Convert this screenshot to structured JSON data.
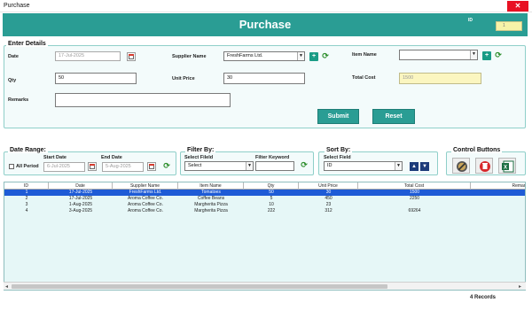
{
  "window": {
    "title": "Purchase",
    "close_glyph": "✕"
  },
  "header": {
    "title": "Purchase",
    "id_label": "ID",
    "id_value": "1"
  },
  "details": {
    "group_title": "Enter Details",
    "date_label": "Date",
    "date_value": "17-Jul-2025",
    "supplier_label": "Supplier Name",
    "supplier_value": "FreshFarms Ltd.",
    "item_label": "Item Name",
    "item_value": "",
    "qty_label": "Qty",
    "qty_value": "50",
    "unit_price_label": "Unit Price",
    "unit_price_value": "30",
    "total_cost_label": "Total Cost",
    "total_cost_value": "1500",
    "remarks_label": "Remarks",
    "remarks_value": "",
    "submit_label": "Submit",
    "reset_label": "Reset",
    "add_glyph": "+"
  },
  "date_range": {
    "title": "Date Range:",
    "start_label": "Start Date",
    "end_label": "End Date",
    "all_period_label": "All Period",
    "start_value": "6-Jul-2025",
    "end_value": "5-Aug-2025"
  },
  "filter": {
    "title": "Filter By:",
    "field_label": "Select Fileld",
    "keyword_label": "Filter Keyword",
    "field_value": "Select",
    "keyword_value": ""
  },
  "sort": {
    "title": "Sort By:",
    "field_label": "Select Field",
    "field_value": "ID",
    "up_glyph": "▲",
    "down_glyph": "▼"
  },
  "controls": {
    "title": "Control Buttons"
  },
  "table": {
    "columns": [
      "ID",
      "Date",
      "Supplier Name",
      "Item Name",
      "Qty",
      "Unit Price",
      "Total Cost",
      "Remark"
    ],
    "rows": [
      [
        "1",
        "17-Jul-2025",
        "FreshFarms Ltd.",
        "Tomatoes",
        "50",
        "30",
        "1500",
        ""
      ],
      [
        "2",
        "17-Jul-2025",
        "Aroma Coffee Co.",
        "Coffee Beans",
        "5",
        "450",
        "2250",
        ""
      ],
      [
        "3",
        "1-Aug-2025",
        "Aroma Coffee Co.",
        "Margherita Pizza",
        "10",
        "23",
        "",
        ""
      ],
      [
        "4",
        "3-Aug-2025",
        "Aroma Coffee Co.",
        "Margherita Pizza",
        "222",
        "312",
        "69264",
        ""
      ]
    ],
    "records_text": "4 Records"
  },
  "colors": {
    "accent": "#2a9d94",
    "selected_row": "#1e5bd6",
    "id_box": "#f7f3a8"
  }
}
